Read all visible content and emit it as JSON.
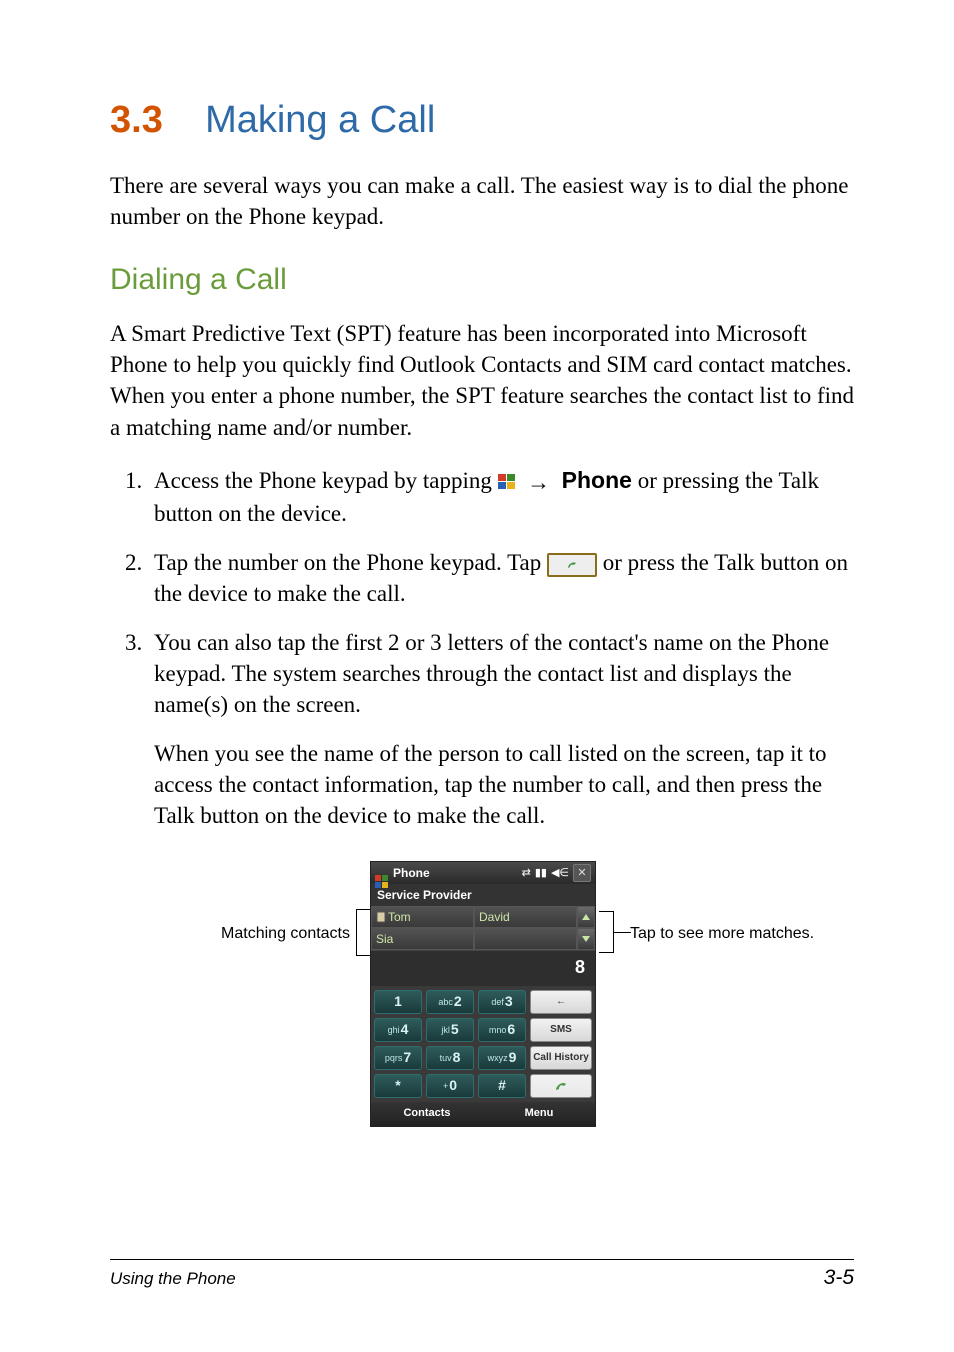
{
  "section": {
    "number": "3.3",
    "title": "Making a Call",
    "intro": "There are several ways you can make a call. The easiest way is to dial the phone number on the Phone keypad."
  },
  "subsection": {
    "title": "Dialing a Call",
    "intro": "A Smart Predictive Text (SPT) feature has been incorporated into Microsoft Phone to help you quickly find Outlook Contacts and SIM card contact matches. When you enter a phone number, the SPT feature searches the contact list to find a matching name and/or number."
  },
  "steps": {
    "s1_pre": "Access the Phone keypad by tapping ",
    "s1_arrow": "→",
    "s1_phone_label": "Phone",
    "s1_post": " or pressing the Talk button on the device.",
    "s2_pre": "Tap the number on the Phone keypad. Tap ",
    "s2_post": " or press the Talk button on the device to make the call.",
    "s3": "You can also tap the first 2 or 3 letters of the contact's name on the Phone keypad. The system searches through the contact list and displays the name(s) on the screen.",
    "s3b": "When you see the name of the person to call listed on the screen, tap it to access the contact information, tap the number to call, and then press the Talk button on the device to make the call."
  },
  "callouts": {
    "left": "Matching contacts",
    "right": "Tap to see more matches."
  },
  "phone": {
    "title": "Phone",
    "provider": "Service Provider",
    "matches": {
      "m1": "Tom",
      "m2": "David",
      "m3": "Sia"
    },
    "dialed": "8",
    "keypad": {
      "k1": {
        "letters": "",
        "digit": "1"
      },
      "k2": {
        "letters": "abc",
        "digit": "2"
      },
      "k3": {
        "letters": "def",
        "digit": "3"
      },
      "k4": {
        "letters": "ghi",
        "digit": "4"
      },
      "k5": {
        "letters": "jkl",
        "digit": "5"
      },
      "k6": {
        "letters": "mno",
        "digit": "6"
      },
      "k7": {
        "letters": "pqrs",
        "digit": "7"
      },
      "k8": {
        "letters": "tuv",
        "digit": "8"
      },
      "k9": {
        "letters": "wxyz",
        "digit": "9"
      },
      "kstar": {
        "letters": "",
        "digit": "*"
      },
      "k0": {
        "letters": "+",
        "digit": "0"
      },
      "khash": {
        "letters": "",
        "digit": "#"
      },
      "backspace": "←",
      "sms": "SMS",
      "history": "Call History"
    },
    "softkeys": {
      "left": "Contacts",
      "right": "Menu"
    }
  },
  "footer": {
    "left": "Using the Phone",
    "right": "3-5"
  }
}
